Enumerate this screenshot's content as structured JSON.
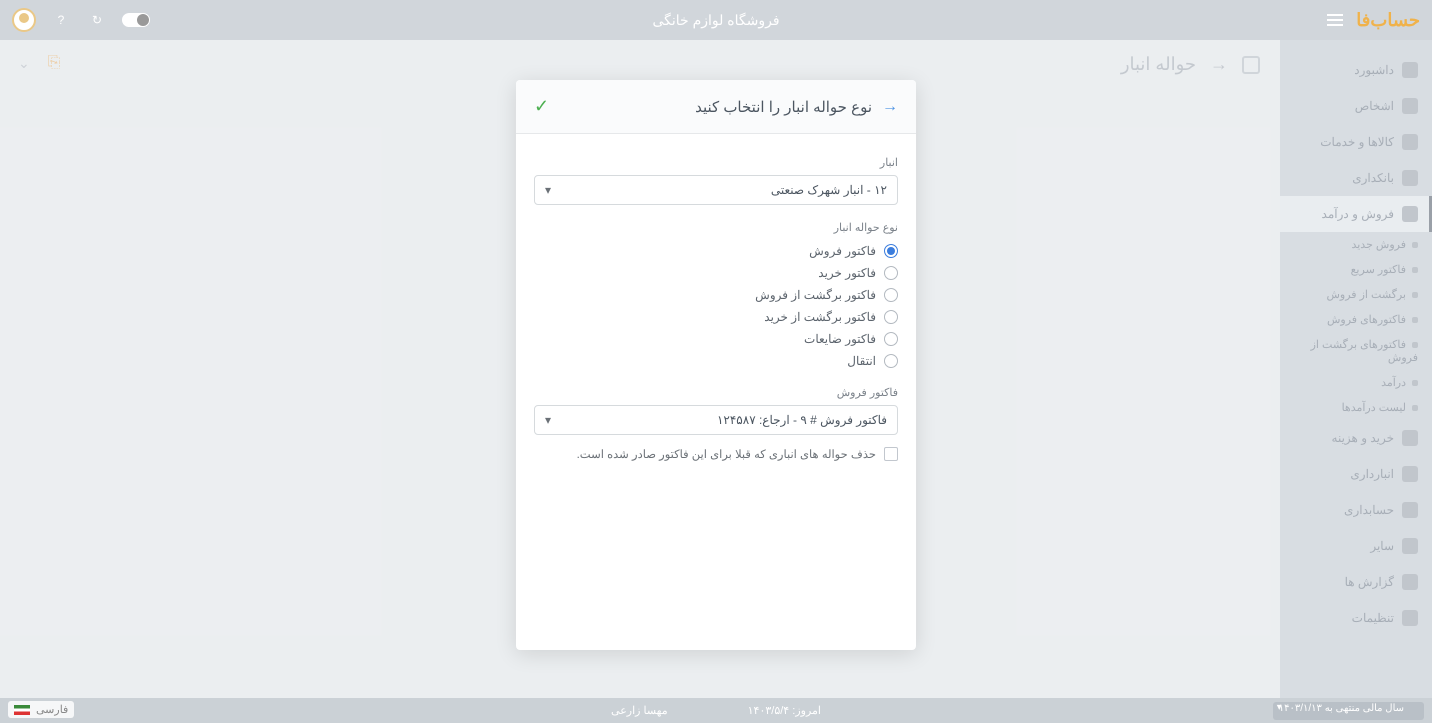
{
  "topbar": {
    "brand": "حساب‌فا",
    "title": "فروشگاه لوازم خانگی"
  },
  "page": {
    "title": "حواله انبار",
    "new_label": ""
  },
  "sidebar": {
    "items": [
      {
        "label": "داشبورد"
      },
      {
        "label": "اشخاص"
      },
      {
        "label": "کالاها و خدمات"
      },
      {
        "label": "بانکداری"
      },
      {
        "label": "فروش و درآمد"
      },
      {
        "label": "خرید و هزینه"
      },
      {
        "label": "انبارداری"
      },
      {
        "label": "حسابداری"
      },
      {
        "label": "سایر"
      },
      {
        "label": "گزارش ها"
      },
      {
        "label": "تنظیمات"
      }
    ],
    "subitems": [
      {
        "label": "فروش جدید"
      },
      {
        "label": "فاکتور سریع"
      },
      {
        "label": "برگشت از فروش"
      },
      {
        "label": "فاکتورهای فروش"
      },
      {
        "label": "فاکتورهای برگشت از فروش"
      },
      {
        "label": "درآمد"
      },
      {
        "label": "لیست درآمدها"
      }
    ]
  },
  "modal": {
    "title": "نوع حواله انبار را انتخاب کنید",
    "warehouse_label": "انبار",
    "warehouse_value": "۱۲ - انبار شهرک صنعتی",
    "type_label": "نوع حواله انبار",
    "types": [
      "فاکتور فروش",
      "فاکتور خرید",
      "فاکتور برگشت از فروش",
      "فاکتور برگشت از خرید",
      "فاکتور ضایعات",
      "انتقال"
    ],
    "invoice_label": "فاکتور فروش",
    "invoice_value": "فاکتور فروش # ۹ - ارجاع: ۱۲۴۵۸۷",
    "delete_prev_label": "حذف حواله های انباری که قبلا برای این فاکتور صادر شده است."
  },
  "bottom": {
    "fiscal": "سال مالی منتهی به ۱۴۰۳/۱/۱۳",
    "today_label": "امروز:",
    "today_value": "۱۴۰۳/۵/۴",
    "user": "مهسا زارعی",
    "lang": "فارسی"
  }
}
